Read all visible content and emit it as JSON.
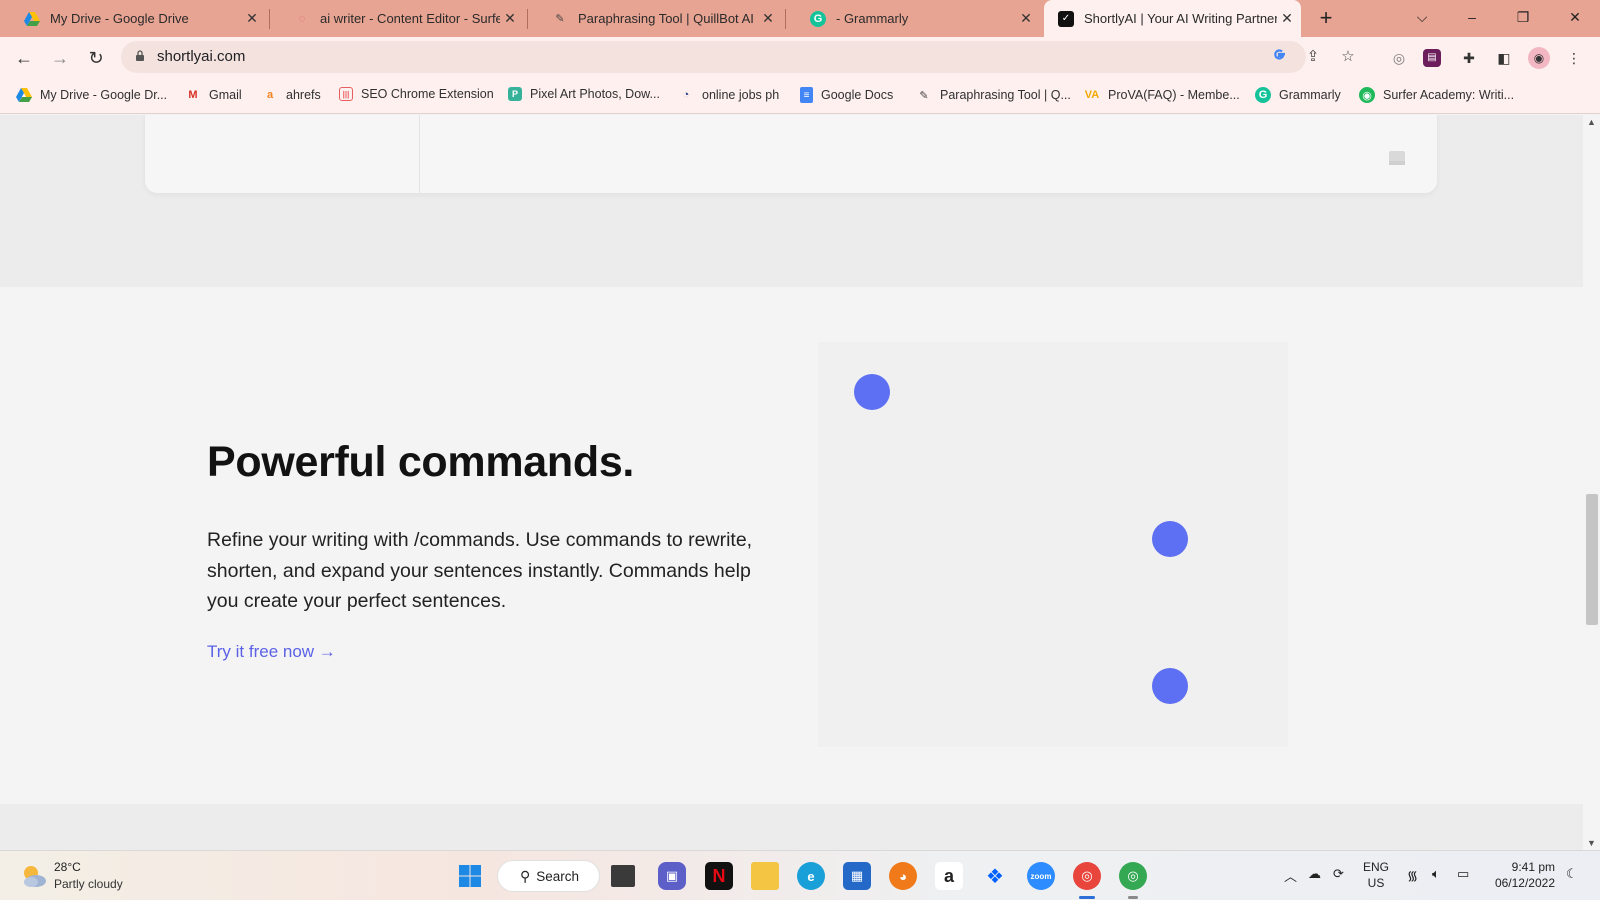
{
  "browser": {
    "tabs": [
      {
        "title": "My Drive - Google Drive",
        "icon": "google-drive-icon"
      },
      {
        "title": "ai writer - Content Editor - Surfer",
        "icon": "surfer-icon"
      },
      {
        "title": "Paraphrasing Tool | QuillBot AI",
        "icon": "quillbot-icon"
      },
      {
        "title": "- Grammarly",
        "icon": "grammarly-icon"
      },
      {
        "title": "ShortlyAI | Your AI Writing Partner",
        "icon": "shortlyai-icon",
        "active": true
      }
    ],
    "new_tab": "+",
    "url": "shortlyai.com",
    "bookmarks": [
      {
        "label": "My Drive - Google Dr...",
        "icon": "google-drive-icon"
      },
      {
        "label": "Gmail",
        "icon": "gmail-icon"
      },
      {
        "label": "ahrefs",
        "icon": "ahrefs-icon"
      },
      {
        "label": "SEO Chrome Extension",
        "icon": "seo-extension-icon"
      },
      {
        "label": "Pixel Art Photos, Dow...",
        "icon": "pixel-art-icon"
      },
      {
        "label": "online jobs ph",
        "icon": "online-jobs-icon"
      },
      {
        "label": "Google Docs",
        "icon": "google-docs-icon"
      },
      {
        "label": "Paraphrasing Tool | Q...",
        "icon": "quillbot-icon"
      },
      {
        "label": "ProVA(FAQ) - Membe...",
        "icon": "prova-icon"
      },
      {
        "label": "Grammarly",
        "icon": "grammarly-icon"
      },
      {
        "label": "Surfer Academy: Writi...",
        "icon": "surfer-academy-icon"
      }
    ]
  },
  "page": {
    "headline": "Powerful commands.",
    "description": "Refine your writing with /commands. Use commands to rewrite, shorten, and expand your sentences instantly. Commands help you create your perfect sentences.",
    "cta": "Try it free now →",
    "accent_color": "#5d6ff2",
    "link_color": "#5b62e6"
  },
  "taskbar": {
    "weather_temp": "28°C",
    "weather_desc": "Partly cloudy",
    "search_label": "Search",
    "language": "ENG",
    "region": "US",
    "time": "9:41 pm",
    "date": "06/12/2022"
  }
}
